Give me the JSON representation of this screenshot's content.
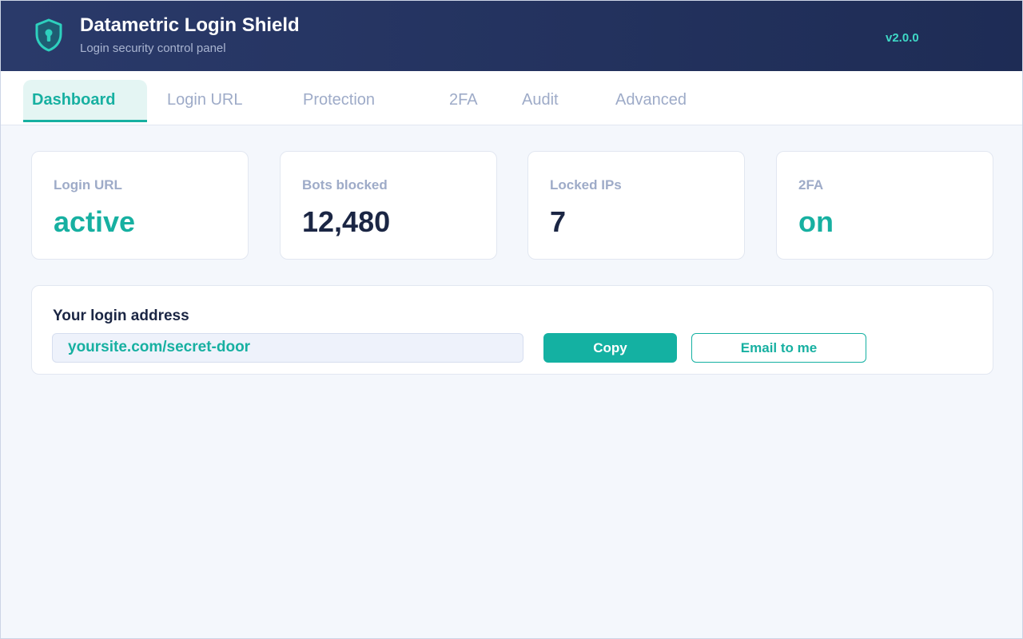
{
  "header": {
    "title": "Datametric Login Shield",
    "subtitle": "Login security control panel",
    "version": "v2.0.0",
    "logo_icon": "shield-keyhole-icon",
    "bg_color": "#1e2c55",
    "accent_color": "#3fd8c6"
  },
  "tabs": [
    {
      "label": "Dashboard",
      "active": true
    },
    {
      "label": "Login URL",
      "active": false
    },
    {
      "label": "Protection",
      "active": false
    },
    {
      "label": "2FA",
      "active": false
    },
    {
      "label": "Audit",
      "active": false
    },
    {
      "label": "Advanced",
      "active": false
    }
  ],
  "stats": [
    {
      "label": "Login URL",
      "value": "active",
      "color": "#17b0a1"
    },
    {
      "label": "Bots blocked",
      "value": "12,480",
      "color": "#1b2644"
    },
    {
      "label": "Locked IPs",
      "value": "7",
      "color": "#1b2644"
    },
    {
      "label": "2FA",
      "value": "on",
      "color": "#17b0a1"
    }
  ],
  "login_address": {
    "title": "Your login address",
    "value": "yoursite.com/secret-door",
    "copy_label": "Copy",
    "email_label": "Email to me"
  }
}
